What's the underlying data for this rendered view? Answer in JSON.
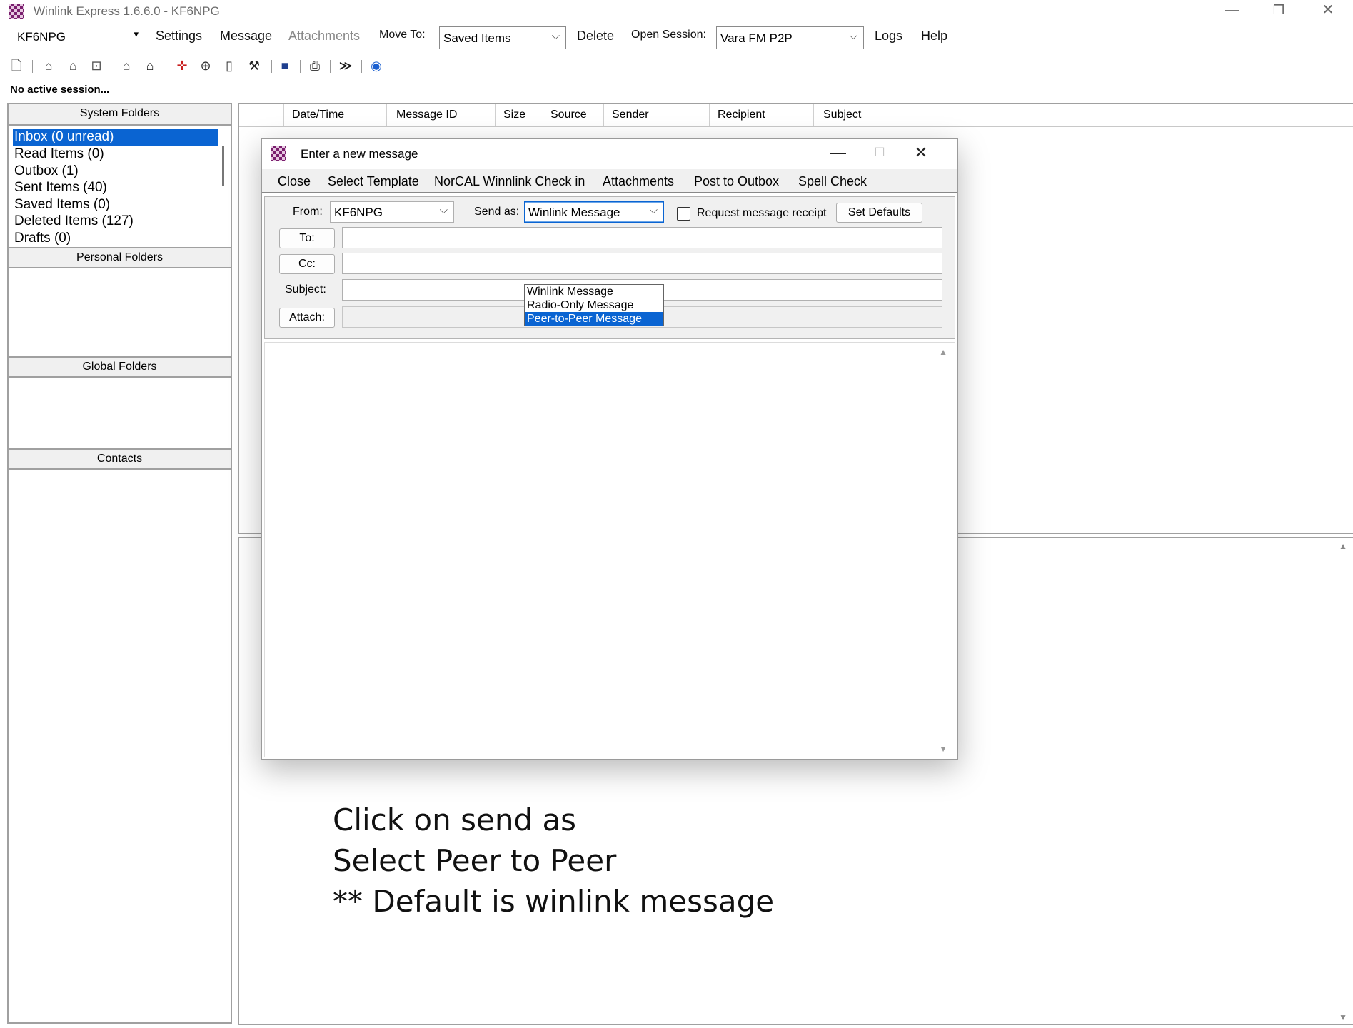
{
  "window": {
    "title": "Winlink Express 1.6.6.0 - KF6NPG",
    "minimize_glyph": "—",
    "restore_glyph": "❐",
    "close_glyph": "✕"
  },
  "menubar": {
    "account": "KF6NPG",
    "account_caret": "▾",
    "settings": "Settings",
    "message": "Message",
    "attachments": "Attachments",
    "move_to_label": "Move To:",
    "move_to_value": "Saved Items",
    "delete": "Delete",
    "open_session_label": "Open Session:",
    "open_session_value": "Vara FM P2P",
    "logs": "Logs",
    "help": "Help",
    "chevron": "⌵"
  },
  "toolbar": {
    "icons": [
      "new-message-icon",
      "open-icon",
      "reply-icon",
      "reply-all-icon",
      "forward-icon",
      "receive-icon",
      "send-icon",
      "position-icon",
      "globe-icon",
      "document-icon",
      "tools-icon",
      "save-icon",
      "print-icon",
      "forward-arrow-icon",
      "help-icon"
    ]
  },
  "status": "No active session...",
  "left_panel": {
    "system_folders": "System Folders",
    "folders": [
      "Inbox  (0 unread)",
      "Read Items  (0)",
      "Outbox  (1)",
      "Sent Items  (40)",
      "Saved Items  (0)",
      "Deleted Items  (127)",
      "Drafts  (0)"
    ],
    "personal_folders": "Personal Folders",
    "global_folders": "Global Folders",
    "contacts": "Contacts"
  },
  "message_list": {
    "columns": [
      "Date/Time",
      "Message ID",
      "Size",
      "Source",
      "Sender",
      "Recipient",
      "Subject"
    ]
  },
  "dialog": {
    "title": "Enter a new message",
    "menu": [
      "Close",
      "Select Template",
      "NorCAL Winnlink Check in",
      "Attachments",
      "Post to Outbox",
      "Spell Check"
    ],
    "from_label": "From:",
    "from_value": "KF6NPG",
    "send_as_label": "Send as:",
    "send_as_value": "Winlink Message",
    "send_as_options": [
      "Winlink Message",
      "Radio-Only Message",
      "Peer-to-Peer Message"
    ],
    "highlighted_option": "Peer-to-Peer Message",
    "request_receipt_label": "Request message receipt",
    "request_receipt_checked": false,
    "set_defaults": "Set Defaults",
    "to_button": "To:",
    "cc_button": "Cc:",
    "subject_label": "Subject:",
    "attach_button": "Attach:",
    "to_value": "",
    "cc_value": "",
    "subject_value": "",
    "body": ""
  },
  "annotation": {
    "line1": "Click on send as",
    "line2": "Select Peer to Peer",
    "line3": "** Default is winlink message"
  },
  "colors": {
    "selection": "#0a64d2",
    "app_icon": "#7a1f6e"
  }
}
